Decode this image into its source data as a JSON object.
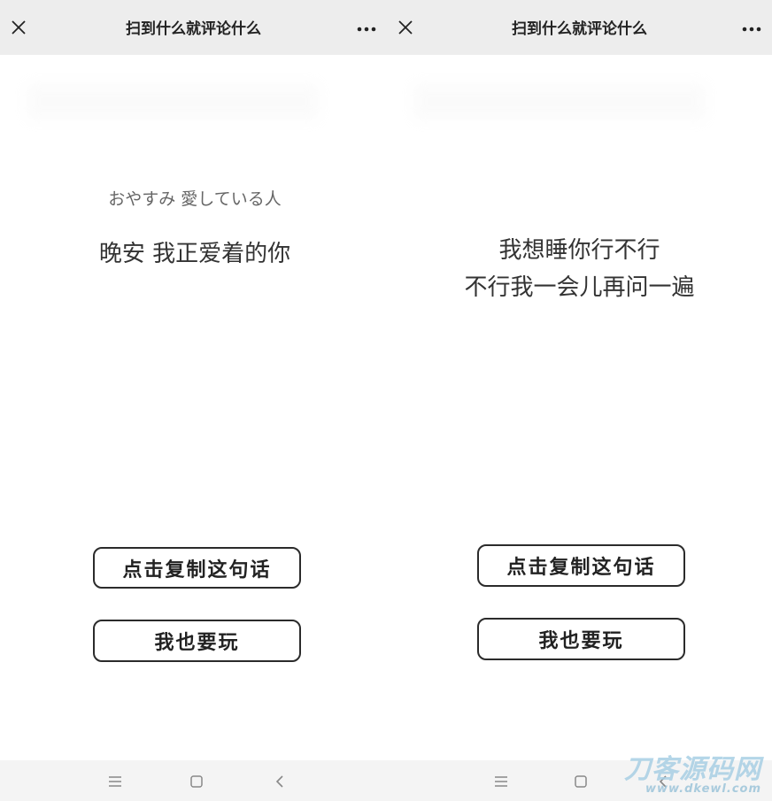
{
  "screens": [
    {
      "header": {
        "title": "扫到什么就评论什么",
        "close_icon": "close-icon",
        "more_icon": "more-dots-icon"
      },
      "banner": {
        "text": ""
      },
      "quote": {
        "subtitle": "おやすみ 愛している人",
        "lines": [
          "晚安 我正爱着的你"
        ]
      },
      "buttons": {
        "copy_label": "点击复制这句话",
        "play_label": "我也要玩"
      },
      "navbar": {
        "icons": [
          "menu-icon",
          "home-square-icon",
          "back-chevron-icon"
        ]
      }
    },
    {
      "header": {
        "title": "扫到什么就评论什么",
        "close_icon": "close-icon",
        "more_icon": "more-dots-icon"
      },
      "banner": {
        "text": ""
      },
      "quote": {
        "subtitle": "",
        "lines": [
          "我想睡你行不行",
          "不行我一会儿再问一遍"
        ]
      },
      "buttons": {
        "copy_label": "点击复制这句话",
        "play_label": "我也要玩"
      },
      "navbar": {
        "icons": [
          "menu-icon",
          "home-square-icon",
          "back-chevron-icon"
        ]
      }
    }
  ],
  "watermark": {
    "brand": "刀客源码网",
    "url": "www.dkewl.com"
  },
  "colors": {
    "topbar_bg": "#ededed",
    "navbar_bg": "#f4f4f4",
    "text": "#333333",
    "button_border": "#2b2b2b"
  }
}
